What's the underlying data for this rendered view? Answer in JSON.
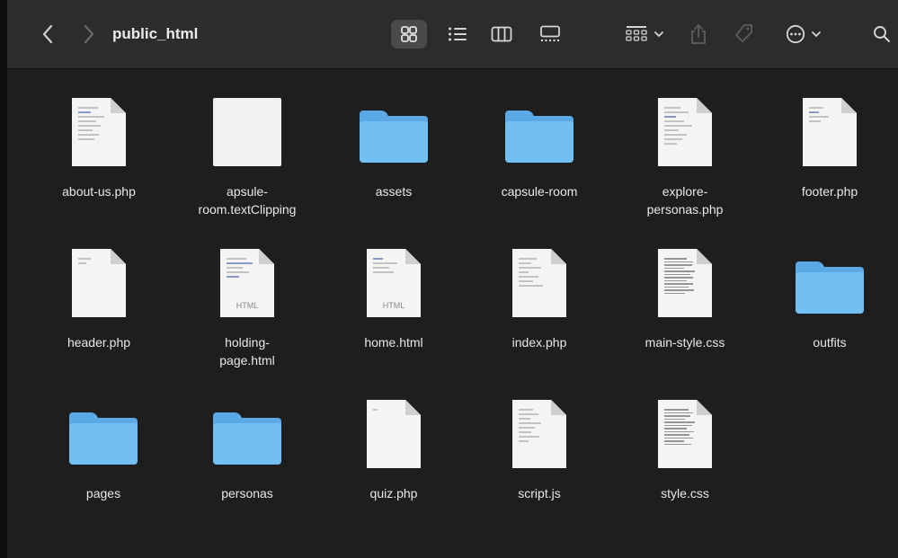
{
  "window": {
    "title": "public_html"
  },
  "toolbar": {
    "buttons": [
      {
        "name": "back",
        "icon": "chevron-left-icon"
      },
      {
        "name": "forward",
        "icon": "chevron-right-icon"
      },
      {
        "name": "icon-view",
        "icon": "grid-icon",
        "active": true
      },
      {
        "name": "list-view",
        "icon": "list-icon"
      },
      {
        "name": "column-view",
        "icon": "columns-icon"
      },
      {
        "name": "gallery-view",
        "icon": "gallery-icon"
      },
      {
        "name": "group",
        "icon": "group-grid-icon"
      },
      {
        "name": "share",
        "icon": "share-icon"
      },
      {
        "name": "tags",
        "icon": "tag-icon"
      },
      {
        "name": "more",
        "icon": "ellipsis-circle-icon"
      },
      {
        "name": "search",
        "icon": "search-icon"
      }
    ]
  },
  "items": [
    {
      "label": "about-us.php",
      "kind": "doc"
    },
    {
      "label": "apsule-\nroom.textClipping",
      "kind": "clip"
    },
    {
      "label": "assets",
      "kind": "folder"
    },
    {
      "label": "capsule-room",
      "kind": "folder"
    },
    {
      "label": "explore-\npersonas.php",
      "kind": "doc"
    },
    {
      "label": "footer.php",
      "kind": "doc"
    },
    {
      "label": "header.php",
      "kind": "doc"
    },
    {
      "label": "holding-\npage.html",
      "kind": "html",
      "tag": "HTML"
    },
    {
      "label": "home.html",
      "kind": "html",
      "tag": "HTML"
    },
    {
      "label": "index.php",
      "kind": "doc"
    },
    {
      "label": "main-style.css",
      "kind": "css"
    },
    {
      "label": "outfits",
      "kind": "folder"
    },
    {
      "label": "pages",
      "kind": "folder"
    },
    {
      "label": "personas",
      "kind": "folder"
    },
    {
      "label": "quiz.php",
      "kind": "doc"
    },
    {
      "label": "script.js",
      "kind": "doc"
    },
    {
      "label": "style.css",
      "kind": "css"
    }
  ],
  "colors": {
    "background": "#1e1e1e",
    "toolbar": "#2c2c2c",
    "folder": "#72bff2",
    "folder_back": "#5aa9e6"
  }
}
